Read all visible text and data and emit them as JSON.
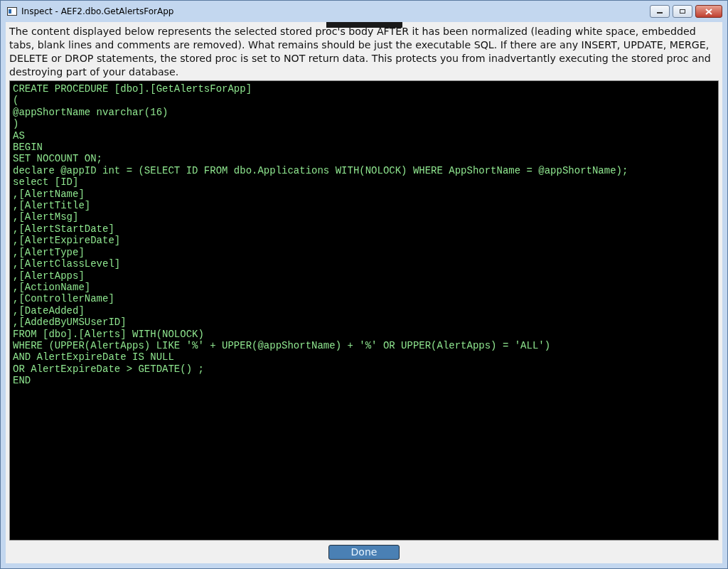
{
  "window": {
    "title": "Inspect -  AEF2.dbo.GetAlertsForApp"
  },
  "description": "The content displayed below represents the selected stored proc's body AFTER it has been normalized (leading white space, embedded tabs, blank lines and comments are removed). What remains should be just the executable SQL. If there are any INSERT, UPDATE, MERGE, DELETE or DROP statements, the stored proc is set to NOT return data. This protects you from inadvertantly executing the stored proc and destroying part of your database.",
  "code_lines": [
    "CREATE PROCEDURE [dbo].[GetAlertsForApp]",
    "(",
    "@appShortName nvarchar(16)",
    ")",
    "AS",
    "BEGIN",
    "SET NOCOUNT ON;",
    "declare @appID int = (SELECT ID FROM dbo.Applications WITH(NOLOCK) WHERE AppShortName = @appShortName);",
    "select [ID]",
    ",[AlertName]",
    ",[AlertTitle]",
    ",[AlertMsg]",
    ",[AlertStartDate]",
    ",[AlertExpireDate]",
    ",[AlertType]",
    ",[AlertClassLevel]",
    ",[AlertApps]",
    ",[ActionName]",
    ",[ControllerName]",
    ",[DateAdded]",
    ",[AddedByUMSUserID]",
    "FROM [dbo].[Alerts] WITH(NOLOCK)",
    "WHERE (UPPER(AlertApps) LIKE '%' + UPPER(@appShortName) + '%' OR UPPER(AlertApps) = 'ALL')",
    "AND AlertExpireDate IS NULL",
    "OR AlertExpireDate > GETDATE() ;",
    "END"
  ],
  "buttons": [
    "Done"
  ]
}
